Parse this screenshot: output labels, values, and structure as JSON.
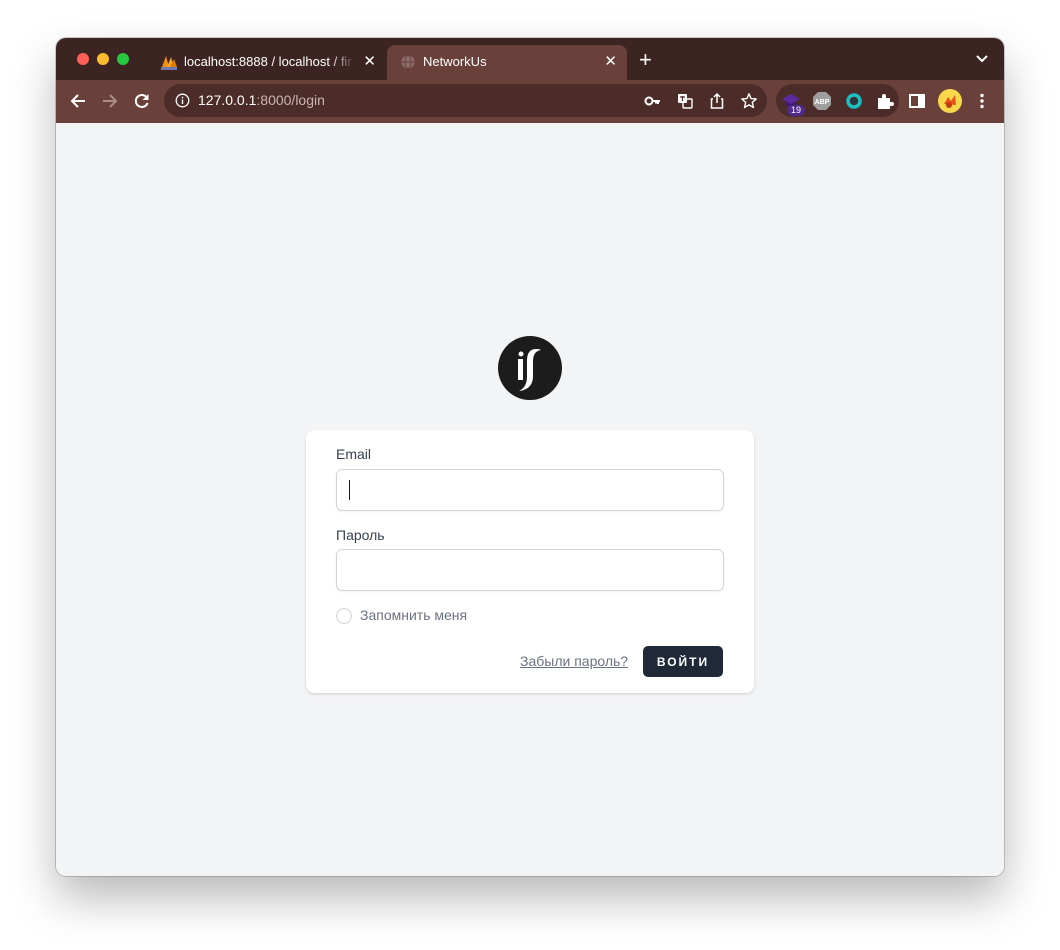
{
  "browser": {
    "tabs": [
      {
        "title": "localhost:8888 / localhost / fir",
        "active": false,
        "favicon": "phpmyadmin-icon"
      },
      {
        "title": "NetworkUs",
        "active": true,
        "favicon": "globe-icon"
      }
    ],
    "tab_close_glyph": "✕",
    "new_tab_glyph": "+",
    "url_host": "127.0.0.1",
    "url_rest": ":8000/login",
    "extension_badge": "19",
    "colors": {
      "tabstrip": "#3b2422",
      "toolbar": "#6a403b",
      "omnibox": "#4c2c28"
    }
  },
  "login": {
    "email_label": "Email",
    "email_value": "",
    "password_label": "Пароль",
    "password_value": "",
    "remember_label": "Запомнить меня",
    "remember_checked": false,
    "forgot_label": "Забыли пароль?",
    "submit_label": "ВОЙТИ",
    "colors": {
      "button": "#1f2937",
      "page_bg": "#f3f4f6",
      "card_bg": "#ffffff"
    }
  }
}
